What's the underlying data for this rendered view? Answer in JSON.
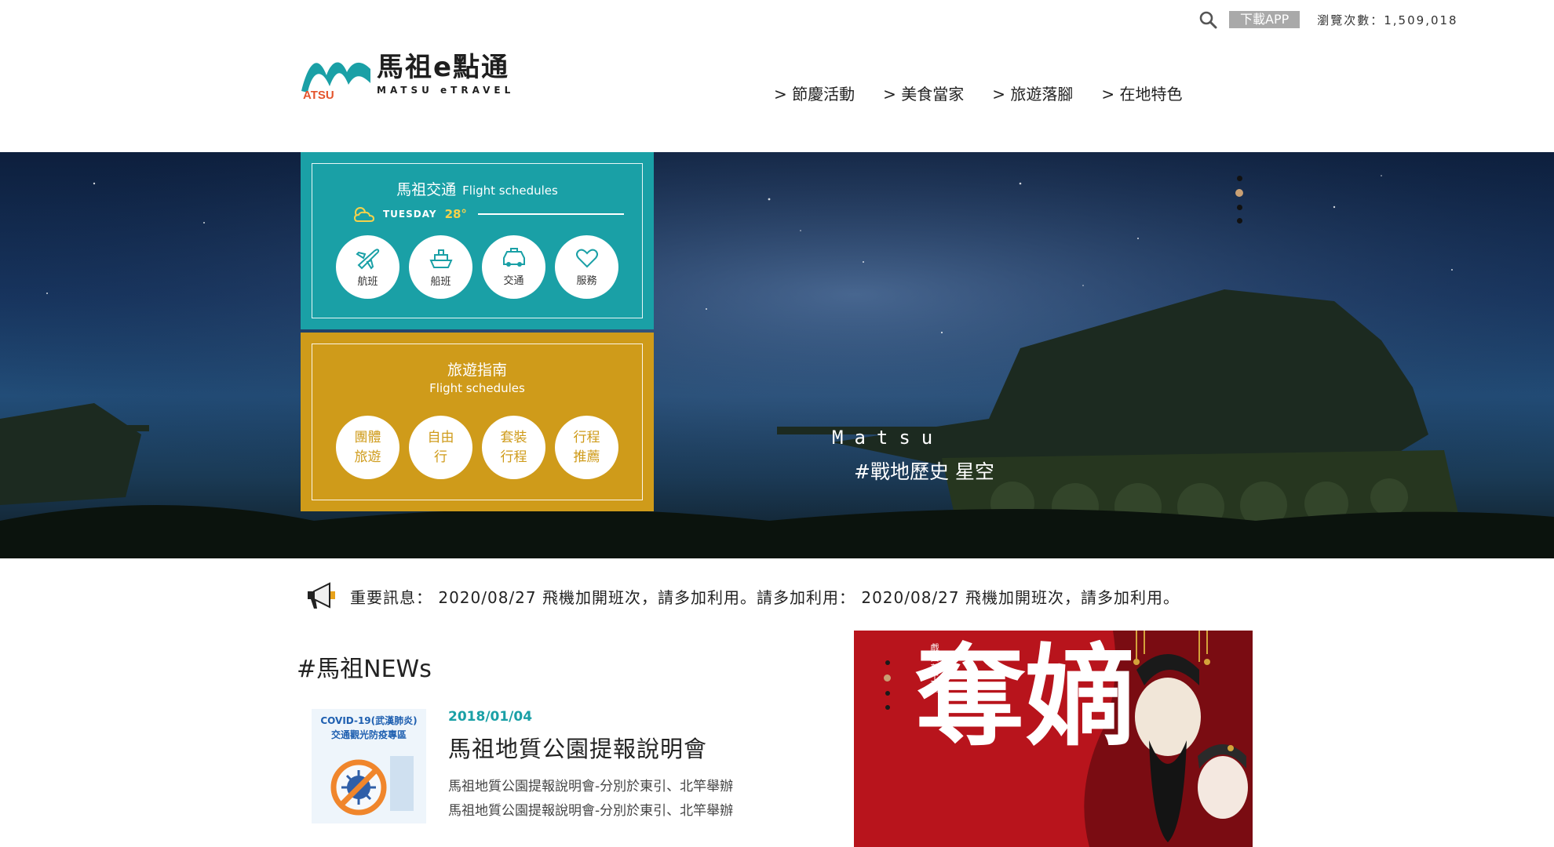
{
  "topbar": {
    "download_app": "下載APP",
    "visits_label": "瀏覽次數：1,509,018"
  },
  "logo": {
    "title": "馬祖e點通",
    "subtitle": "MATSU eTRAVEL",
    "mark_text": "ATSU"
  },
  "nav": {
    "items": [
      "> 節慶活動",
      "> 美食當家",
      "> 旅遊落腳",
      "> 在地特色"
    ]
  },
  "hero": {
    "caption_line1": "Matsu",
    "caption_line2": "#戰地歷史 星空",
    "slides_total": 4,
    "active_slide": 2
  },
  "transport_panel": {
    "title": "馬祖交通",
    "subtitle": "Flight schedules",
    "weather_day": "TUESDAY",
    "weather_temp": "28°",
    "buttons": [
      "航班",
      "船班",
      "交通",
      "服務"
    ]
  },
  "guide_panel": {
    "title": "旅遊指南",
    "subtitle": "Flight schedules",
    "buttons": [
      [
        "團體",
        "旅遊"
      ],
      [
        "自由",
        "行"
      ],
      [
        "套裝",
        "行程"
      ],
      [
        "行程",
        "推薦"
      ]
    ]
  },
  "ticker": {
    "text": "重要訊息： 2020/08/27 飛機加開班次，請多加利用。請多加利用： 2020/08/27 飛機加開班次，請多加利用。"
  },
  "news": {
    "section_title": "#馬祖NEWs",
    "thumb_text_line1": "COVID-19(武漢肺炎)",
    "thumb_text_line2": "交通觀光防疫專區",
    "date": "2018/01/04",
    "headline": "馬祖地質公園提報說明會",
    "desc_line1": "馬祖地質公園提報說明會-分別於東引、北竿舉辦",
    "desc_line2": "馬祖地質公園提報說明會-分別於東引、北竿舉辦"
  },
  "banner": {
    "big_text": "奪嫡",
    "small_text": "戲曲夢工場",
    "slides_total": 4,
    "active_slide": 2
  },
  "colors": {
    "teal": "#1aa0a6",
    "gold": "#cf9b1a",
    "banner_red": "#b8141c"
  }
}
